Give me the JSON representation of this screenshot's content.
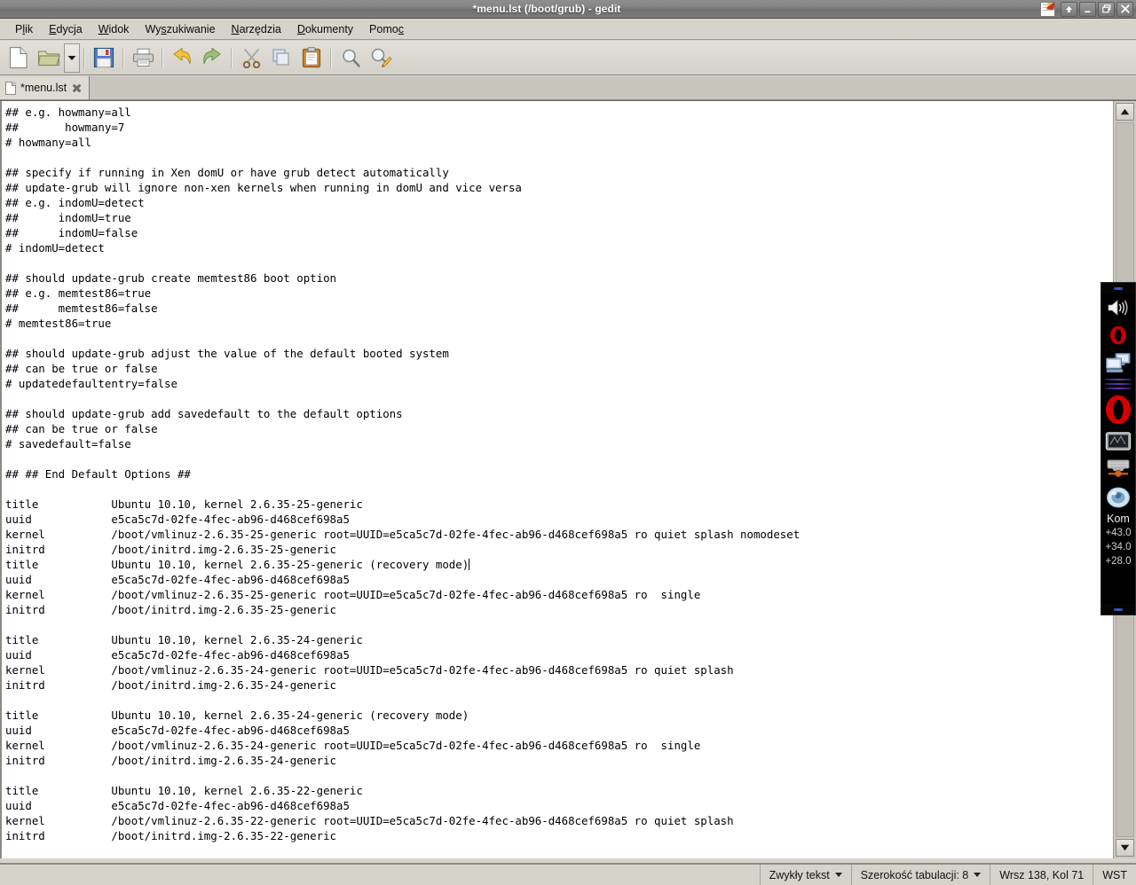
{
  "window": {
    "title": "*menu.lst (/boot/grub) - gedit",
    "controls": {
      "rollup": "rollup-button",
      "minimize": "minimize-button",
      "maximize": "maximize-button",
      "close": "close-button"
    }
  },
  "menubar": {
    "items": [
      {
        "name": "menu-plik",
        "pre": "P",
        "mnemonic": "l",
        "post": "ik"
      },
      {
        "name": "menu-edycja",
        "pre": "",
        "mnemonic": "E",
        "post": "dycja"
      },
      {
        "name": "menu-widok",
        "pre": "",
        "mnemonic": "W",
        "post": "idok"
      },
      {
        "name": "menu-wyszukiwanie",
        "pre": "Wy",
        "mnemonic": "s",
        "post": "zukiwanie"
      },
      {
        "name": "menu-narzedzia",
        "pre": "",
        "mnemonic": "N",
        "post": "arzędzia"
      },
      {
        "name": "menu-dokumenty",
        "pre": "",
        "mnemonic": "D",
        "post": "okumenty"
      },
      {
        "name": "menu-pomoc",
        "pre": "Pomo",
        "mnemonic": "c",
        "post": ""
      }
    ]
  },
  "toolbar": {
    "buttons": [
      {
        "name": "new-document-icon",
        "label": "Nowy"
      },
      {
        "name": "open-folder-icon",
        "label": "Otwórz"
      },
      {
        "name": "open-dropdown-icon",
        "label": "Otwórz ostatnie"
      },
      {
        "name": "save-icon",
        "label": "Zapisz"
      },
      {
        "name": "print-icon",
        "label": "Drukuj"
      },
      {
        "name": "undo-icon",
        "label": "Cofnij"
      },
      {
        "name": "redo-icon",
        "label": "Ponów"
      },
      {
        "name": "cut-scissors-icon",
        "label": "Wytnij"
      },
      {
        "name": "copy-icon",
        "label": "Kopiuj"
      },
      {
        "name": "paste-clipboard-icon",
        "label": "Wklej"
      },
      {
        "name": "find-magnifier-icon",
        "label": "Znajdź"
      },
      {
        "name": "find-replace-icon",
        "label": "Zamień"
      }
    ]
  },
  "tabs": [
    {
      "name": "tab-menu-lst",
      "label": "*menu.lst",
      "modified": true
    }
  ],
  "editor": {
    "text": "## e.g. howmany=all\n##       howmany=7\n# howmany=all\n\n## specify if running in Xen domU or have grub detect automatically\n## update-grub will ignore non-xen kernels when running in domU and vice versa\n## e.g. indomU=detect\n##      indomU=true\n##      indomU=false\n# indomU=detect\n\n## should update-grub create memtest86 boot option\n## e.g. memtest86=true\n##      memtest86=false\n# memtest86=true\n\n## should update-grub adjust the value of the default booted system\n## can be true or false\n# updatedefaultentry=false\n\n## should update-grub add savedefault to the default options\n## can be true or false\n# savedefault=false\n\n## ## End Default Options ##\n\ntitle           Ubuntu 10.10, kernel 2.6.35-25-generic\nuuid            e5ca5c7d-02fe-4fec-ab96-d468cef698a5\nkernel          /boot/vmlinuz-2.6.35-25-generic root=UUID=e5ca5c7d-02fe-4fec-ab96-d468cef698a5 ro quiet splash nomodeset\ninitrd          /boot/initrd.img-2.6.35-25-generic\n",
    "caret_line_prefix": "title           Ubuntu 10.10, kernel 2.6.35-25-generic (recovery mode)",
    "text_after_caret": "\nuuid            e5ca5c7d-02fe-4fec-ab96-d468cef698a5\nkernel          /boot/vmlinuz-2.6.35-25-generic root=UUID=e5ca5c7d-02fe-4fec-ab96-d468cef698a5 ro  single\ninitrd          /boot/initrd.img-2.6.35-25-generic\n\ntitle           Ubuntu 10.10, kernel 2.6.35-24-generic\nuuid            e5ca5c7d-02fe-4fec-ab96-d468cef698a5\nkernel          /boot/vmlinuz-2.6.35-24-generic root=UUID=e5ca5c7d-02fe-4fec-ab96-d468cef698a5 ro quiet splash\ninitrd          /boot/initrd.img-2.6.35-24-generic\n\ntitle           Ubuntu 10.10, kernel 2.6.35-24-generic (recovery mode)\nuuid            e5ca5c7d-02fe-4fec-ab96-d468cef698a5\nkernel          /boot/vmlinuz-2.6.35-24-generic root=UUID=e5ca5c7d-02fe-4fec-ab96-d468cef698a5 ro  single\ninitrd          /boot/initrd.img-2.6.35-24-generic\n\ntitle           Ubuntu 10.10, kernel 2.6.35-22-generic\nuuid            e5ca5c7d-02fe-4fec-ab96-d468cef698a5\nkernel          /boot/vmlinuz-2.6.35-22-generic root=UUID=e5ca5c7d-02fe-4fec-ab96-d468cef698a5 ro quiet splash\ninitrd          /boot/initrd.img-2.6.35-22-generic"
  },
  "statusbar": {
    "language": "Zwykły tekst",
    "tab_width": "Szerokość tabulacji: 8",
    "position": "Wrsz 138, Kol 71",
    "insert_mode": "WST"
  },
  "dock": {
    "icons": [
      {
        "name": "volume-speaker-icon"
      },
      {
        "name": "opera-small-icon"
      },
      {
        "name": "network-computers-icon"
      },
      {
        "name": "opera-large-icon"
      },
      {
        "name": "screen-monitor-icon"
      },
      {
        "name": "hardware-device-icon"
      },
      {
        "name": "water-drop-icon"
      }
    ],
    "sensor_label": "Kom",
    "temps": [
      "+43.0",
      "+34.0",
      "+28.0"
    ]
  },
  "colors": {
    "chrome": "#d6d3cb",
    "titlebar": "#7c7c7c",
    "editor_bg": "#ffffff",
    "dock_bg": "#000000",
    "opera_red": "#cc0000"
  }
}
